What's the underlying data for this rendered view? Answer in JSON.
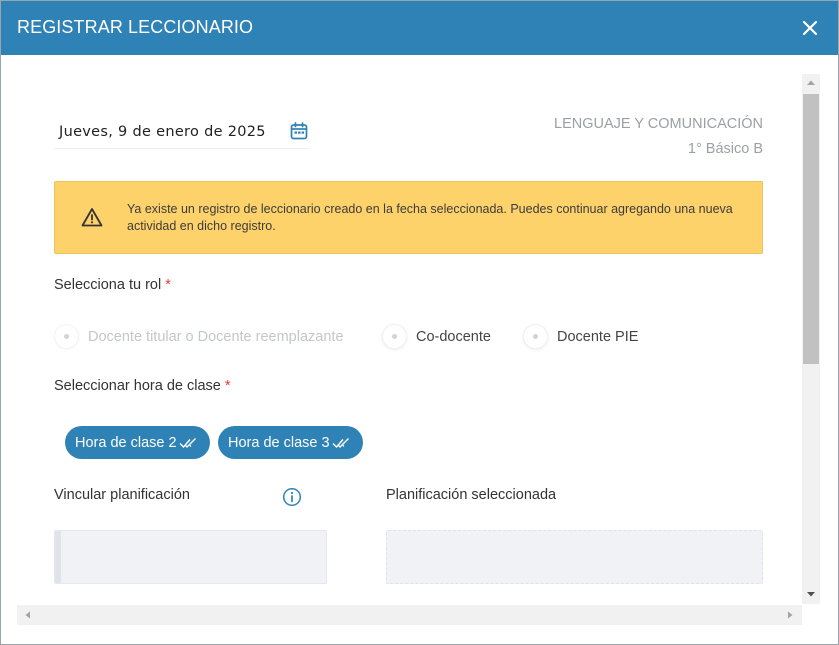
{
  "header": {
    "title": "REGISTRAR LECCIONARIO"
  },
  "date": {
    "value": "Jueves, 9 de enero de 2025"
  },
  "subject": {
    "name": "LENGUAJE Y COMUNICACIÓN",
    "course": "1° Básico B"
  },
  "alert": {
    "message": "Ya existe un registro de leccionario creado en la fecha seleccionada. Puedes continuar agregando una nueva actividad en dicho registro."
  },
  "role": {
    "label": "Selecciona tu rol",
    "required_mark": "*",
    "options": [
      "Docente titular o Docente reemplazante",
      "Co-docente",
      "Docente PIE"
    ]
  },
  "hours": {
    "label": "Seleccionar hora de clase",
    "required_mark": "*",
    "chips": [
      "Hora de clase 2",
      "Hora de clase 3"
    ]
  },
  "planning": {
    "link_label": "Vincular planificación",
    "selected_label": "Planificación seleccionada"
  },
  "colors": {
    "header": "#2f82b5",
    "alert": "#fdd26b",
    "required": "#e53935",
    "chip": "#2f82b5"
  },
  "icons": {
    "close": "close-icon",
    "calendar": "calendar-icon",
    "warning": "warning-icon",
    "info": "info-icon",
    "check": "double-check-icon"
  }
}
